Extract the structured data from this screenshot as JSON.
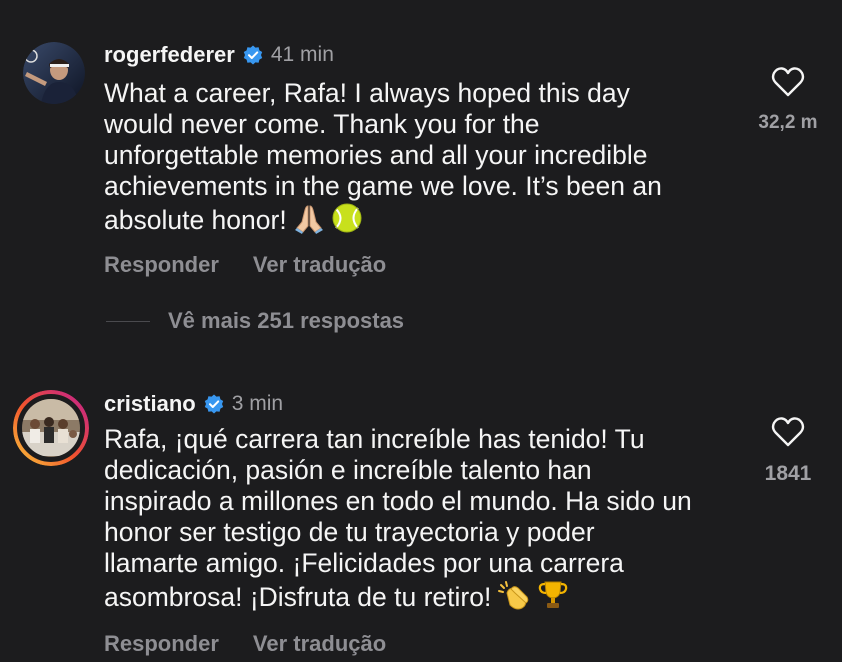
{
  "comments": [
    {
      "username": "rogerfederer",
      "timestamp": "41 min",
      "lines": [
        "What a career, Rafa! I always hoped this day",
        "would never come. Thank you for the",
        "unforgettable memories and all your incredible",
        "achievements in the game we love. It’s been an",
        "absolute honor!"
      ],
      "emojis": [
        "praying-hands-emoji",
        "tennis-ball-emoji"
      ],
      "reply_label": "Responder",
      "translate_label": "Ver tradução",
      "like_count": "32,2 m",
      "view_replies": "Vê mais 251 respostas"
    },
    {
      "username": "cristiano",
      "timestamp": "3 min",
      "lines": [
        "Rafa, ¡qué carrera tan increíble has tenido! Tu",
        "dedicación, pasión e increíble talento han",
        "inspirado a millones en todo el mundo. Ha sido un",
        "honor ser testigo de tu trayectoria y poder",
        "llamarte amigo. ¡Felicidades por una carrera",
        "asombrosa! ¡Disfruta de tu retiro!"
      ],
      "emojis": [
        "clapping-hands-emoji",
        "trophy-emoji"
      ],
      "reply_label": "Responder",
      "translate_label": "Ver tradução",
      "like_count": "1841"
    }
  ],
  "icons": {
    "verified": "verified-badge-icon",
    "like": "heart-outline-icon"
  },
  "colors": {
    "background": "#1c1c1e",
    "text": "#f5f5f5",
    "secondary": "#8e8e93",
    "verified": "#3897f0"
  }
}
